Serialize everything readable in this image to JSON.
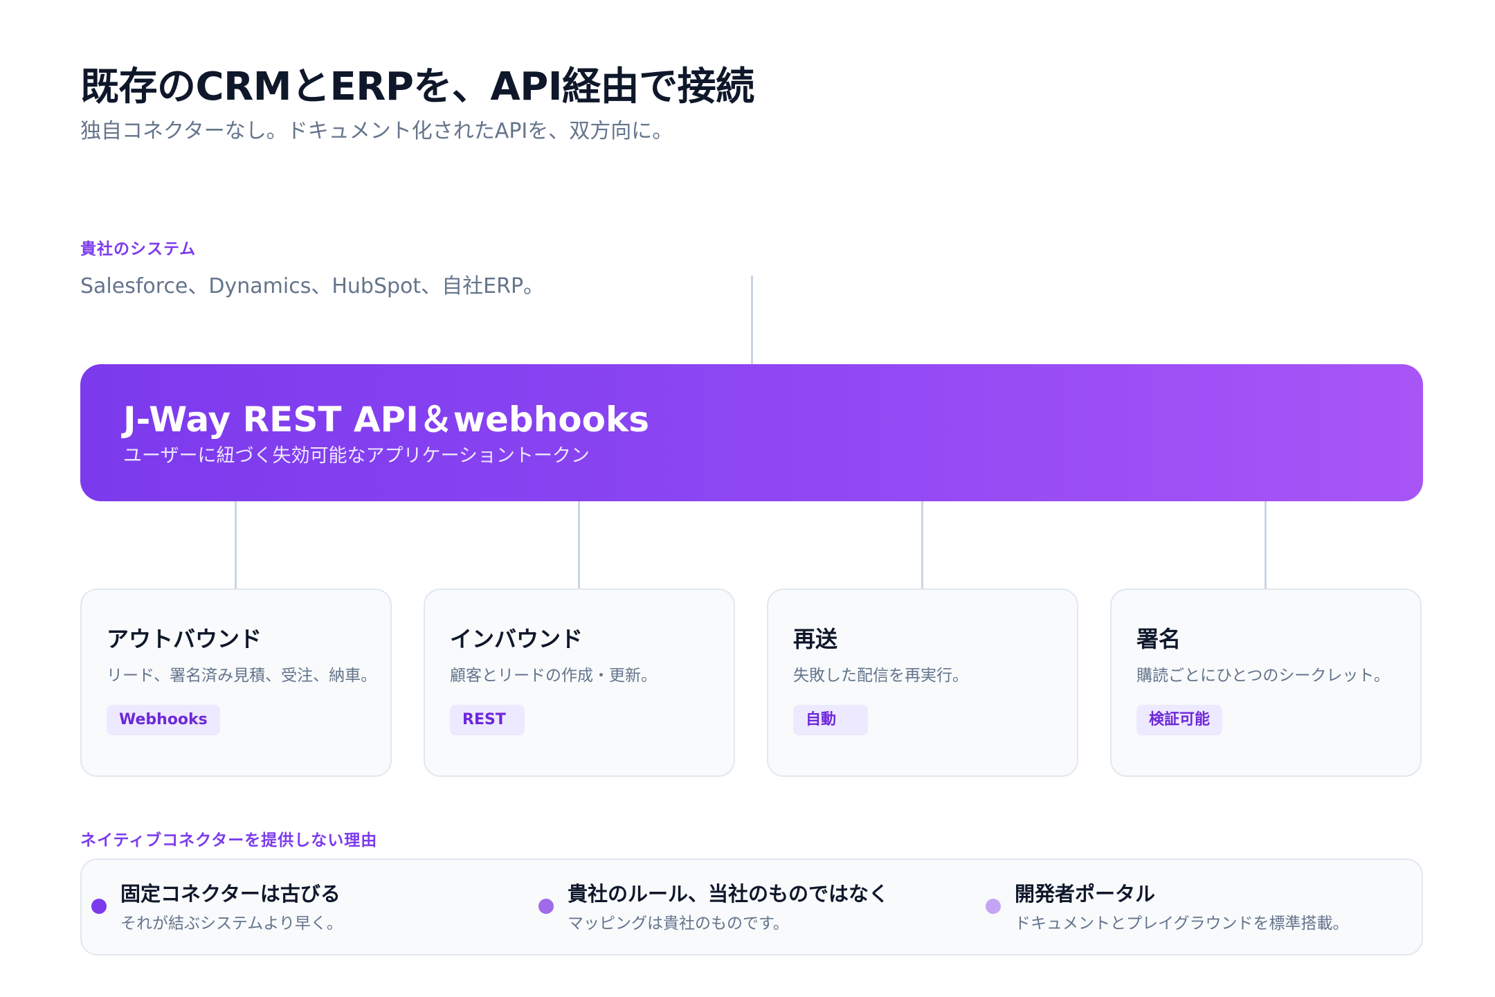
{
  "header": {
    "title": "既存のCRMとERPを、API経由で接続",
    "subtitle": "独自コネクターなし。ドキュメント化されたAPIを、双方向に。"
  },
  "systems": {
    "eyebrow": "貴社のシステム",
    "list": "Salesforce、Dynamics、HubSpot、自社ERP。"
  },
  "api": {
    "title": "J-Way REST API＆webhooks",
    "subtitle": "ユーザーに紐づく失効可能なアプリケーショントークン"
  },
  "cards": [
    {
      "title": "アウトバウンド",
      "desc": "リード、署名済み見積、受注、納車。",
      "tag": "Webhooks"
    },
    {
      "title": "インバウンド",
      "desc": "顧客とリードの作成・更新。",
      "tag": "REST"
    },
    {
      "title": "再送",
      "desc": "失敗した配信を再実行。",
      "tag": "自動"
    },
    {
      "title": "署名",
      "desc": "購読ごとにひとつのシークレット。",
      "tag": "検証可能"
    }
  ],
  "reasons": {
    "eyebrow": "ネイティブコネクターを提供しない理由",
    "items": [
      {
        "title": "固定コネクターは古びる",
        "desc": "それが結ぶシステムより早く。",
        "color": "#7c3aed"
      },
      {
        "title": "貴社のルール、当社のものではなく",
        "desc": "マッピングは貴社のものです。",
        "color": "#a06ae8"
      },
      {
        "title": "開発者ポータル",
        "desc": "ドキュメントとプレイグラウンドを標準搭載。",
        "color": "#c4a5f3"
      }
    ]
  },
  "colors": {
    "accent": "#7c3aed",
    "gradient_end": "#a855f7",
    "connector": "#cbd5e1",
    "tag_bg": "#ede9fe"
  }
}
